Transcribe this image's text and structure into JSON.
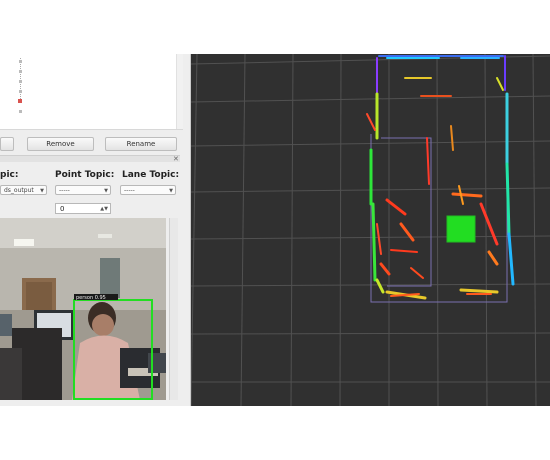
{
  "buttons": {
    "partial": "",
    "rename": "Rename",
    "remove": "Remove"
  },
  "topics": {
    "first_label": "pic:",
    "point_label": "Point Topic:",
    "lane_label": "Lane Topic:",
    "first_value": "ds_output",
    "point_value": "-----",
    "lane_value": "-----"
  },
  "spin_value": "0",
  "detection": {
    "label": "person 0.95"
  },
  "colors": {
    "panel_bg": "#eeeeee",
    "rviz_bg": "#303030",
    "grid": "#505050",
    "box_green": "#22dd22"
  }
}
